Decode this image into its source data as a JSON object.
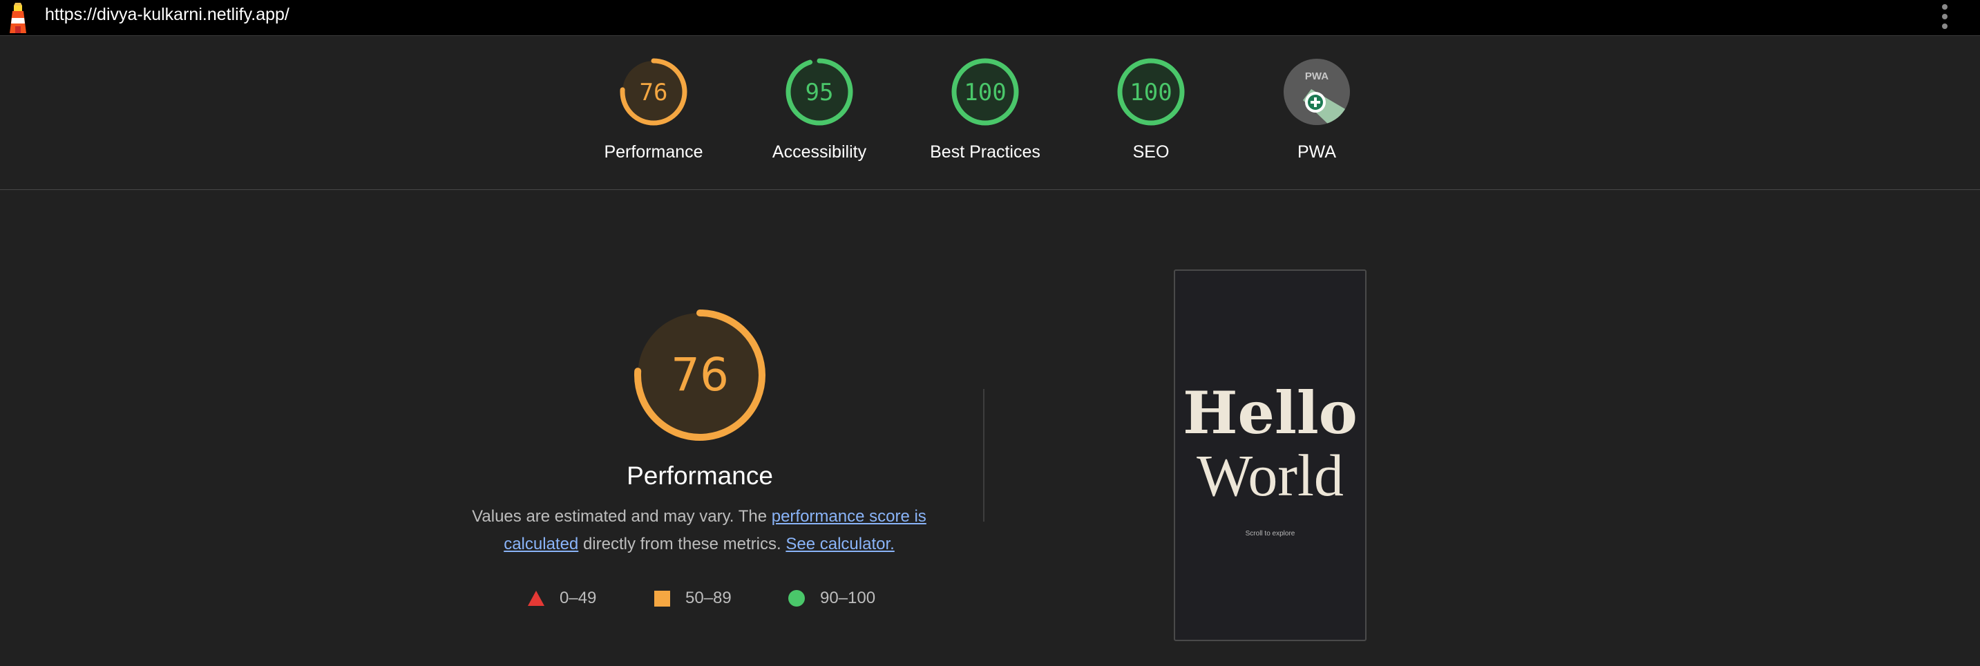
{
  "topbar": {
    "url": "https://divya-kulkarni.netlify.app/"
  },
  "summary": {
    "categories": [
      {
        "label": "Performance",
        "score": "76",
        "fraction": 0.76,
        "rating": "average"
      },
      {
        "label": "Accessibility",
        "score": "95",
        "fraction": 0.95,
        "rating": "pass"
      },
      {
        "label": "Best Practices",
        "score": "100",
        "fraction": 1.0,
        "rating": "pass"
      },
      {
        "label": "SEO",
        "score": "100",
        "fraction": 1.0,
        "rating": "pass"
      },
      {
        "label": "PWA",
        "badge_text": "PWA",
        "icon": "pwa-badge-icon"
      }
    ]
  },
  "performance": {
    "score": "76",
    "fraction": 0.76,
    "title": "Performance",
    "desc_prefix": "Values are estimated and may vary. The ",
    "link_score_calc": "performance score is calculated",
    "desc_middle": " directly from these metrics. ",
    "link_calculator": "See calculator.",
    "legend": [
      {
        "shape": "triangle",
        "range": "0–49"
      },
      {
        "shape": "square",
        "range": "50–89"
      },
      {
        "shape": "circle",
        "range": "90–100"
      }
    ]
  },
  "screenshot": {
    "line1": "Hello",
    "line2": "World",
    "hint": "Scroll to explore"
  },
  "colors": {
    "background": "#212121",
    "average": "#f5a742",
    "pass": "#4ac76a",
    "fail": "#e53935",
    "link": "#8ab4f8"
  }
}
